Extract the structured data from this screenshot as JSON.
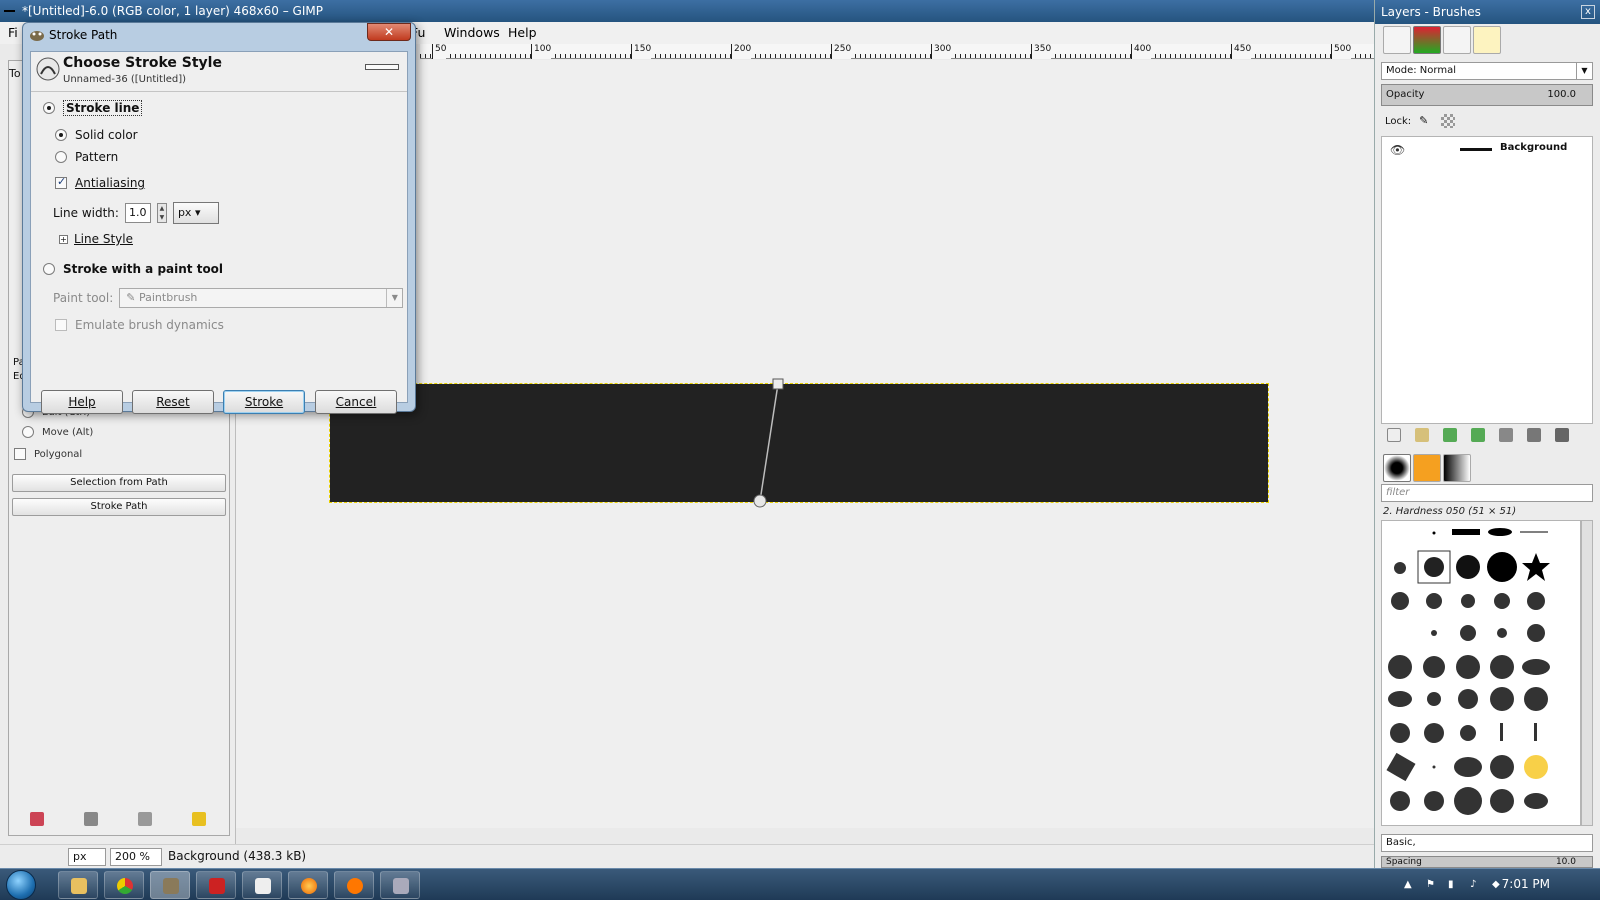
{
  "window": {
    "title": "*[Untitled]-6.0 (RGB color, 1 layer) 468x60 – GIMP"
  },
  "menu": {
    "items": [
      "Fi",
      "Fu",
      "Windows",
      "Help"
    ]
  },
  "ruler": {
    "labels": [
      "50",
      "100",
      "150",
      "200",
      "250",
      "300",
      "350",
      "400",
      "450",
      "500"
    ]
  },
  "status": {
    "unit": "px",
    "zoom": "200 %",
    "layer_info": "Background (438.3 kB)"
  },
  "toolbox": {
    "fragment_p": "Pa",
    "fragment_e": "Ed",
    "fragment_to": "To",
    "edit_mode": "Edit (Ctrl)",
    "move_mode": "Move (Alt)",
    "polygonal": "Polygonal",
    "selection_from_path": "Selection from Path",
    "stroke_path": "Stroke Path"
  },
  "dock": {
    "title": "Layers - Brushes",
    "close": "x",
    "mode_label": "Mode: Normal",
    "opacity_label": "Opacity",
    "opacity_value": "100.0",
    "lock_label": "Lock:",
    "layer_name": "Background",
    "brush_filter_placeholder": "filter",
    "brush_name": "2. Hardness 050 (51 × 51)",
    "brush_tag": "Basic,",
    "spacing_label": "Spacing",
    "spacing_value": "10.0"
  },
  "dialog": {
    "title": "Stroke Path",
    "close": "✕",
    "header_title": "Choose Stroke Style",
    "header_subtitle": "Unnamed-36 ([Untitled])",
    "stroke_line": "Stroke line",
    "solid_color": "Solid color",
    "pattern": "Pattern",
    "antialiasing": "Antialiasing",
    "line_width_label": "Line width:",
    "line_width_value": "1.0",
    "unit": "px",
    "line_style": "Line Style",
    "stroke_with_tool": "Stroke with a paint tool",
    "paint_tool_label": "Paint tool:",
    "paint_tool_value": "Paintbrush",
    "emulate_dynamics": "Emulate brush dynamics",
    "btn_help": "Help",
    "btn_reset": "Reset",
    "btn_stroke": "Stroke",
    "btn_cancel": "Cancel"
  },
  "taskbar": {
    "clock": "7:01 PM"
  },
  "colors": {
    "title_bar": "#2d5f8f",
    "canvas_bg": "#efefef",
    "image_fill": "#222222",
    "selection_marching_ants": "#e8d000",
    "dialog_frame": "#b8cde2",
    "close_button": "#c94a2e"
  },
  "icons": [
    "start-orb",
    "explorer-icon",
    "chrome-icon",
    "gimp-icon",
    "filezilla-icon",
    "notepad-icon",
    "firefox-icon",
    "xampp-icon",
    "gimp-dialog-icon",
    "eye-icon",
    "brush-lock-icon",
    "checker-lock-icon"
  ]
}
